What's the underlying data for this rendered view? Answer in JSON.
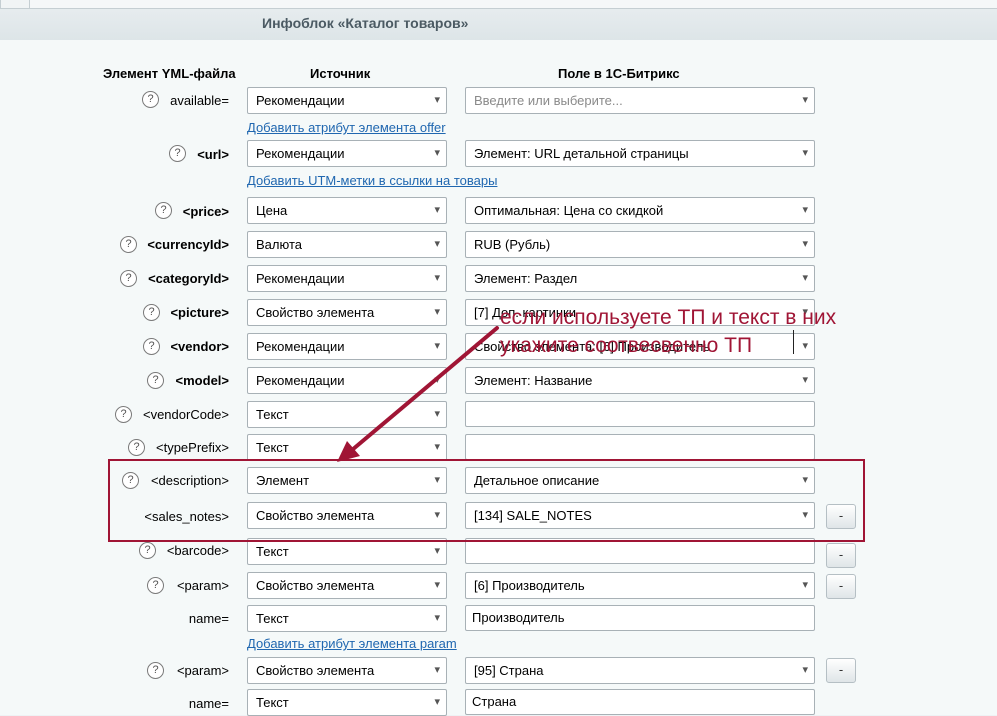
{
  "header": {
    "infoblock_title": "Инфоблок «Каталог товаров»"
  },
  "columns": {
    "yml_element": "Элемент YML-файла",
    "source": "Источник",
    "bitrix_field": "Поле в 1С-Битрикс"
  },
  "rows": {
    "available": {
      "label": "available=",
      "source": "Рекомендации",
      "field": "Введите или выберите...",
      "link": "Добавить атрибут элемента offer"
    },
    "url": {
      "label": "<url>",
      "source": "Рекомендации",
      "field": "Элемент: URL детальной страницы",
      "link": "Добавить UTM-метки в ссылки на товары"
    },
    "price": {
      "label": "<price>",
      "source": "Цена",
      "field": "Оптимальная: Цена со скидкой"
    },
    "currencyid": {
      "label": "<currencyId>",
      "source": "Валюта",
      "field": "RUB (Рубль)"
    },
    "categoryid": {
      "label": "<categoryId>",
      "source": "Рекомендации",
      "field": "Элемент: Раздел"
    },
    "picture": {
      "label": "<picture>",
      "source": "Свойство элемента",
      "field": "[7] Доп. картинки"
    },
    "vendor": {
      "label": "<vendor>",
      "source": "Рекомендации",
      "field": "Свойство элемента: [6] Производитель"
    },
    "model": {
      "label": "<model>",
      "source": "Рекомендации",
      "field": "Элемент: Название"
    },
    "vendorcode": {
      "label": "<vendorCode>",
      "source": "Текст",
      "field": ""
    },
    "typeprefix": {
      "label": "<typePrefix>",
      "source": "Текст",
      "field": ""
    },
    "description": {
      "label": "<description>",
      "source": "Элемент",
      "field": "Детальное описание"
    },
    "sales_notes": {
      "label": "<sales_notes>",
      "source": "Свойство элемента",
      "field": "[134] SALE_NOTES",
      "remove": "-"
    },
    "barcode": {
      "label": "<barcode>",
      "source": "Текст",
      "field": "",
      "remove": "-"
    },
    "param1": {
      "label": "<param>",
      "source": "Свойство элемента",
      "field": "[6] Производитель",
      "remove": "-"
    },
    "param1_name": {
      "label": "name=",
      "source": "Текст",
      "field": "Производитель",
      "link": "Добавить атрибут элемента param"
    },
    "param2": {
      "label": "<param>",
      "source": "Свойство элемента",
      "field": "[95] Страна",
      "remove": "-"
    },
    "param2_name": {
      "label": "name=",
      "source": "Текст",
      "field": "Страна"
    }
  },
  "annotation": {
    "line1": "если используете ТП и текст в них",
    "line2": "укажите соотвесвенно ТП"
  },
  "glyphs": {
    "help": "?",
    "chevron": "▾"
  },
  "colors": {
    "annotation": "#a01535",
    "link": "#2067b0"
  }
}
